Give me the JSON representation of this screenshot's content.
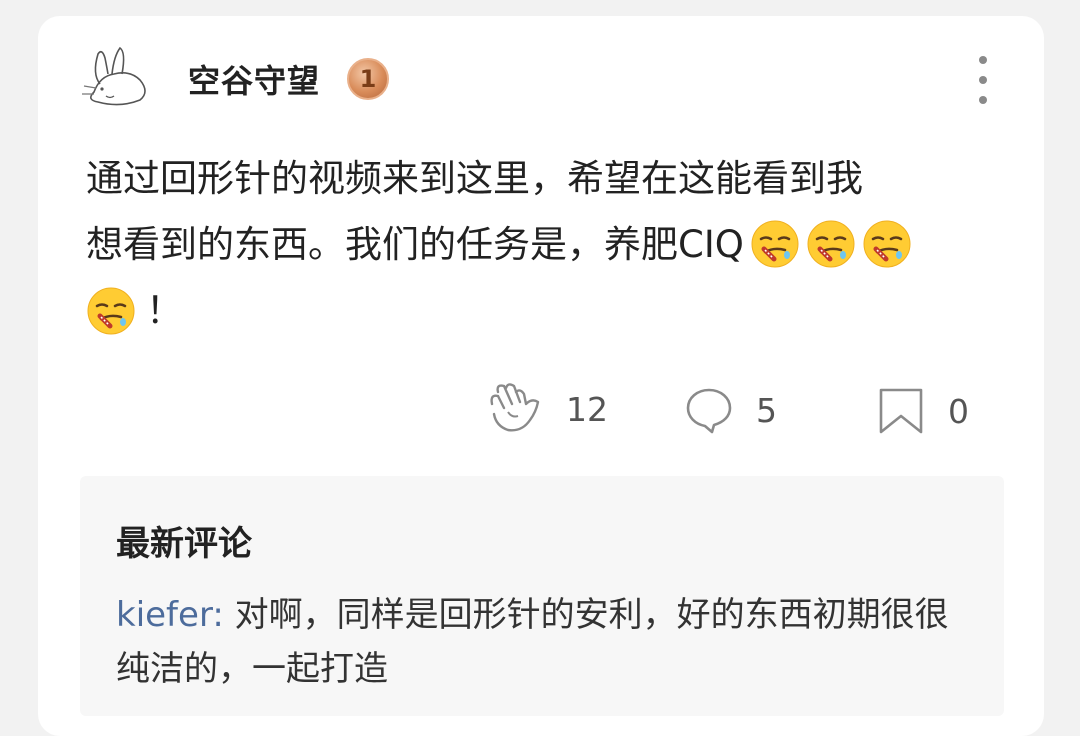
{
  "post": {
    "author": {
      "name": "空谷守望",
      "level": "1",
      "avatar_icon": "rabbit-sketch-avatar"
    },
    "more_icon": "vertical-dots-icon",
    "text_line1": "通过回形针的视频来到这里，希望在这能看到我",
    "text_line2": "想看到的东西。我们的任务是，养肥CIQ",
    "text_trailing": "！",
    "emoji": "drooling-face-emoji",
    "emoji_count": 4
  },
  "actions": {
    "like": {
      "icon": "clap-hand-icon",
      "count": "12"
    },
    "comment": {
      "icon": "comment-bubble-icon",
      "count": "5"
    },
    "save": {
      "icon": "bookmark-icon",
      "count": "0"
    }
  },
  "comments": {
    "title": "最新评论",
    "items": [
      {
        "author": "kiefer",
        "separator": ": ",
        "text": "对啊，同样是回形针的安利，好的东西初期很很纯洁的，一起打造"
      }
    ]
  },
  "colors": {
    "background": "#f2f2f2",
    "card": "#ffffff",
    "comment_panel": "#f7f7f7",
    "author_link": "#4d6c9c",
    "badge": "#d98c5a"
  }
}
